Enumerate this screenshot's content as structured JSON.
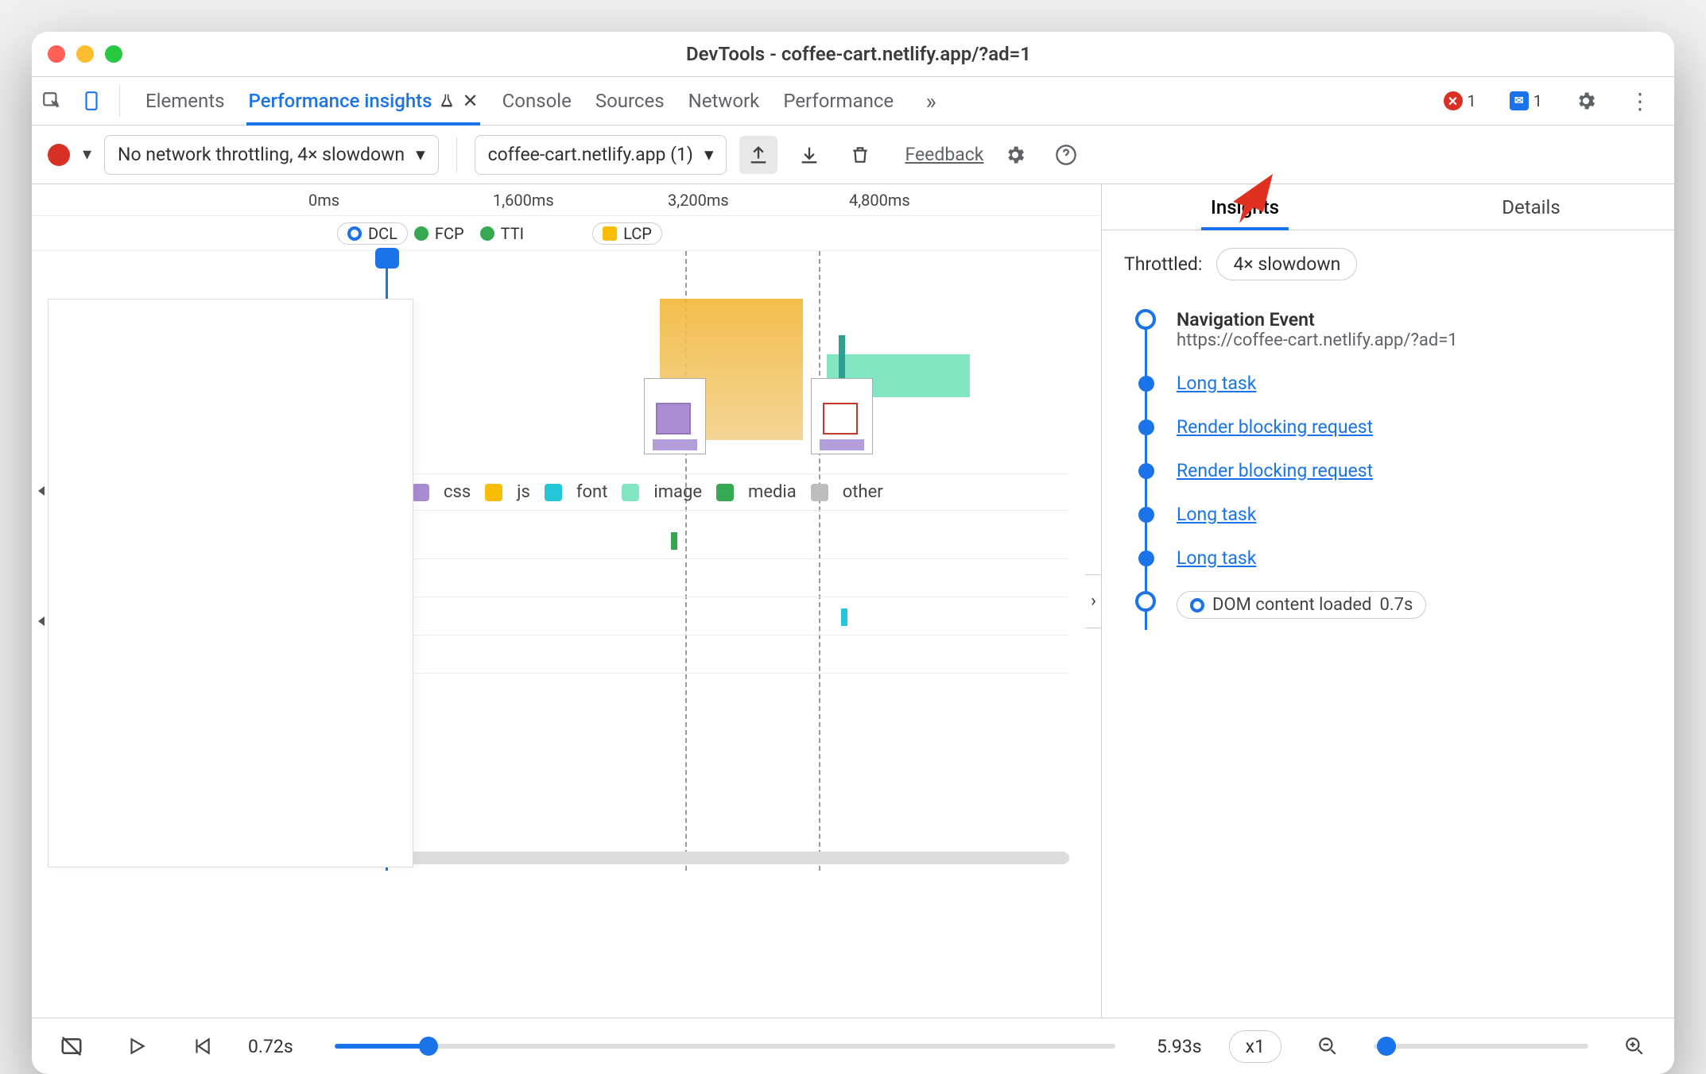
{
  "window": {
    "title": "DevTools - coffee-cart.netlify.app/?ad=1"
  },
  "toolbar": {
    "tabs": [
      "Elements",
      "Performance insights",
      "Console",
      "Sources",
      "Network",
      "Performance"
    ],
    "active_tab": 1,
    "errors_count": "1",
    "messages_count": "1"
  },
  "secondbar": {
    "throttling": "No network throttling, 4× slowdown",
    "session": "coffee-cart.netlify.app (1)",
    "feedback": "Feedback"
  },
  "timeline": {
    "ticks": [
      "0ms",
      "1,600ms",
      "3,200ms",
      "4,800ms"
    ],
    "markers": [
      {
        "label": "DCL",
        "color": "#1a73e8",
        "ring": true
      },
      {
        "label": "FCP",
        "color": "#34a853"
      },
      {
        "label": "TTI",
        "color": "#34a853"
      },
      {
        "label": "LCP",
        "color": "#fbbc04"
      }
    ],
    "legend": [
      {
        "label": "css",
        "color": "#a98cd1"
      },
      {
        "label": "js",
        "color": "#fbbc04"
      },
      {
        "label": "font",
        "color": "#26c6da"
      },
      {
        "label": "image",
        "color": "#81e6c1"
      },
      {
        "label": "media",
        "color": "#34a853"
      },
      {
        "label": "other",
        "color": "#bdbdbd"
      }
    ]
  },
  "sidebar": {
    "tabs": [
      "Insights",
      "Details"
    ],
    "active": 0,
    "throttled_label": "Throttled:",
    "throttled_value": "4× slowdown",
    "nav_title": "Navigation Event",
    "nav_url": "https://coffee-cart.netlify.app/?ad=1",
    "items": [
      "Long task",
      "Render blocking request",
      "Render blocking request",
      "Long task",
      "Long task"
    ],
    "dcl_label": "DOM content loaded",
    "dcl_time": "0.7s"
  },
  "playback": {
    "current": "0.72s",
    "total": "5.93s",
    "speed": "x1"
  }
}
